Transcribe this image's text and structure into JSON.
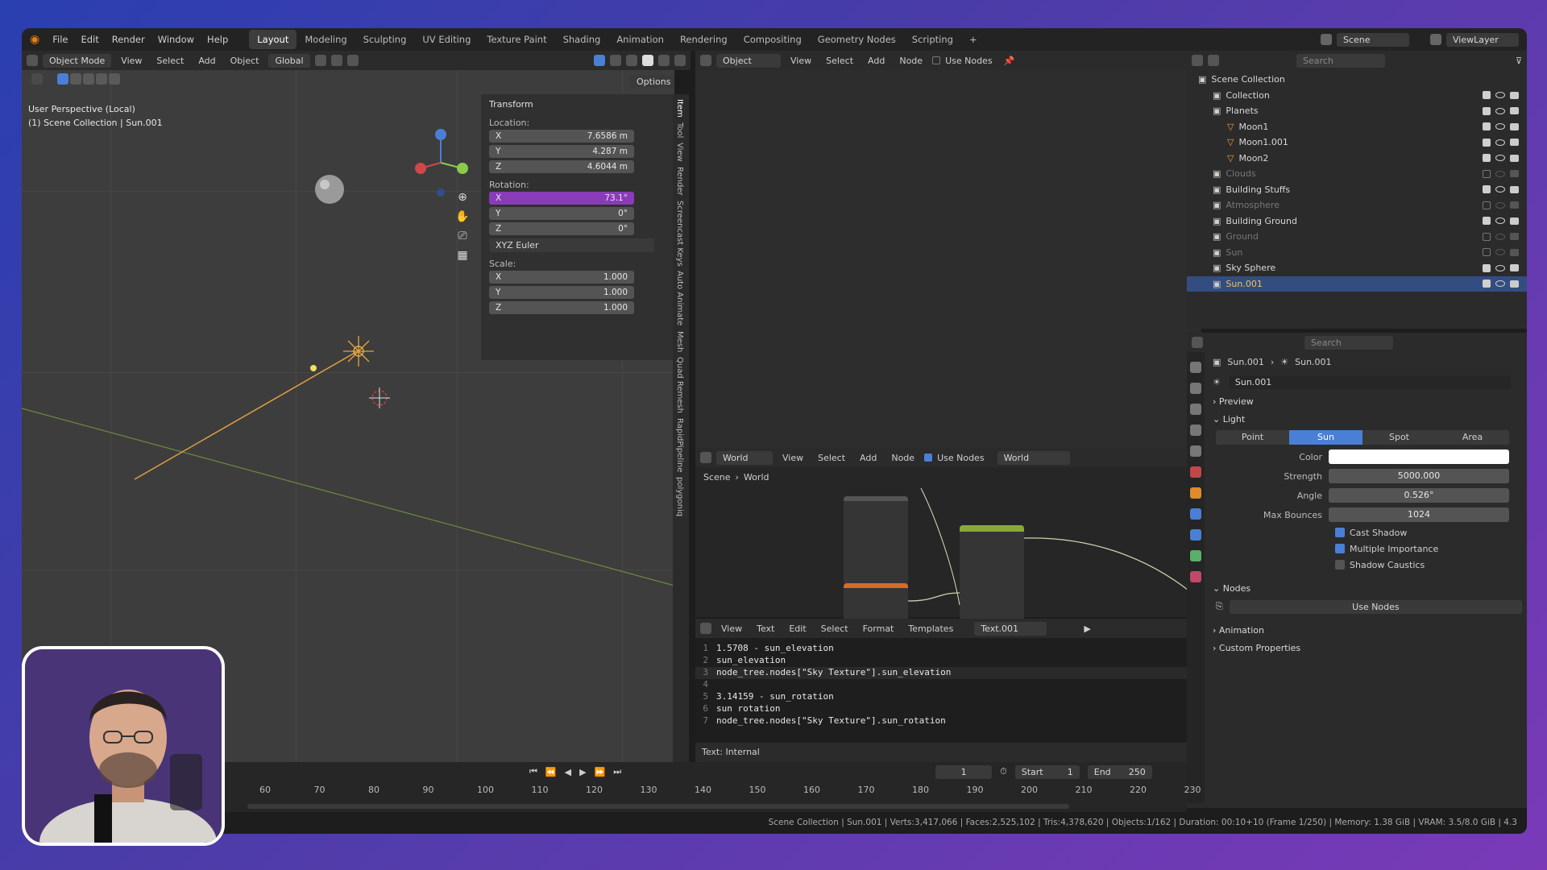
{
  "menus": [
    "File",
    "Edit",
    "Render",
    "Window",
    "Help"
  ],
  "workspaces": [
    "Layout",
    "Modeling",
    "Sculpting",
    "UV Editing",
    "Texture Paint",
    "Shading",
    "Animation",
    "Rendering",
    "Compositing",
    "Geometry Nodes",
    "Scripting",
    "+"
  ],
  "topright": {
    "scene": "Scene",
    "viewlayer": "ViewLayer"
  },
  "viewport": {
    "mode": "Object Mode",
    "menu": [
      "View",
      "Select",
      "Add",
      "Object"
    ],
    "orientation": "Global",
    "options": "Options",
    "overlay_line1": "User Perspective (Local)",
    "overlay_line2": "(1) Scene Collection | Sun.001"
  },
  "transform": {
    "title": "Transform",
    "location_label": "Location:",
    "rotation_label": "Rotation:",
    "scale_label": "Scale:",
    "location": [
      {
        "axis": "X",
        "value": "7.6586 m"
      },
      {
        "axis": "Y",
        "value": "4.287 m"
      },
      {
        "axis": "Z",
        "value": "4.6044 m"
      }
    ],
    "rotation": [
      {
        "axis": "X",
        "value": "73.1°"
      },
      {
        "axis": "Y",
        "value": "0°"
      },
      {
        "axis": "Z",
        "value": "0°"
      }
    ],
    "rotation_mode": "XYZ Euler",
    "scale": [
      {
        "axis": "X",
        "value": "1.000"
      },
      {
        "axis": "Y",
        "value": "1.000"
      },
      {
        "axis": "Z",
        "value": "1.000"
      }
    ]
  },
  "side_tabs": [
    "Item",
    "Tool",
    "View",
    "Render",
    "Screencast Keys",
    "Auto Animate",
    "Mesh",
    "Quad Remesh",
    "RapidPipeline",
    "polygoniq"
  ],
  "shader_top": {
    "type": "Object",
    "menu": [
      "View",
      "Select",
      "Add",
      "Node"
    ],
    "use_nodes": "Use Nodes"
  },
  "shader_world": {
    "type": "World",
    "menu": [
      "View",
      "Select",
      "Add",
      "Node"
    ],
    "use_nodes": "Use Nodes",
    "world": "World",
    "bc_scene": "Scene",
    "bc_world": "World"
  },
  "text_editor": {
    "menu": [
      "View",
      "Text",
      "Edit",
      "Select",
      "Format",
      "Templates"
    ],
    "filename": "Text.001",
    "footer": "Text: Internal",
    "lines": [
      {
        "n": "1",
        "t": "1.5708 - sun_elevation"
      },
      {
        "n": "2",
        "t": "sun_elevation"
      },
      {
        "n": "3",
        "t": "node_tree.nodes[\"Sky Texture\"].sun_elevation"
      },
      {
        "n": "4",
        "t": ""
      },
      {
        "n": "5",
        "t": "3.14159 - sun_rotation"
      },
      {
        "n": "6",
        "t": "sun rotation"
      },
      {
        "n": "7",
        "t": "node_tree.nodes[\"Sky Texture\"].sun_rotation"
      }
    ]
  },
  "outliner": {
    "search": "Search",
    "items": [
      {
        "name": "Scene Collection",
        "depth": 0,
        "dim": false,
        "sel": false
      },
      {
        "name": "Collection",
        "depth": 1,
        "dim": false,
        "sel": false
      },
      {
        "name": "Planets",
        "depth": 1,
        "dim": false,
        "sel": false
      },
      {
        "name": "Moon1",
        "depth": 2,
        "dim": false,
        "sel": false
      },
      {
        "name": "Moon1.001",
        "depth": 2,
        "dim": false,
        "sel": false
      },
      {
        "name": "Moon2",
        "depth": 2,
        "dim": false,
        "sel": false
      },
      {
        "name": "Clouds",
        "depth": 1,
        "dim": true,
        "sel": false
      },
      {
        "name": "Building Stuffs",
        "depth": 1,
        "dim": false,
        "sel": false
      },
      {
        "name": "Atmosphere",
        "depth": 1,
        "dim": true,
        "sel": false
      },
      {
        "name": "Building Ground",
        "depth": 1,
        "dim": false,
        "sel": false
      },
      {
        "name": "Ground",
        "depth": 1,
        "dim": true,
        "sel": false
      },
      {
        "name": "Sun",
        "depth": 1,
        "dim": true,
        "sel": false
      },
      {
        "name": "Sky Sphere",
        "depth": 1,
        "dim": false,
        "sel": false
      },
      {
        "name": "Sun.001",
        "depth": 1,
        "dim": false,
        "sel": true
      }
    ]
  },
  "properties": {
    "search": "Search",
    "bc_object": "Sun.001",
    "bc_data": "Sun.001",
    "datablock": "Sun.001",
    "preview": "Preview",
    "light": "Light",
    "light_types": [
      "Point",
      "Sun",
      "Spot",
      "Area"
    ],
    "fields": [
      {
        "label": "Color",
        "value": ""
      },
      {
        "label": "Strength",
        "value": "5000.000"
      },
      {
        "label": "Angle",
        "value": "0.526°"
      },
      {
        "label": "Max Bounces",
        "value": "1024"
      }
    ],
    "checks": [
      {
        "label": "Cast Shadow",
        "on": true
      },
      {
        "label": "Multiple Importance",
        "on": true
      },
      {
        "label": "Shadow Caustics",
        "on": false
      }
    ],
    "nodes": "Nodes",
    "use_nodes": "Use Nodes",
    "animation": "Animation",
    "custom": "Custom Properties"
  },
  "timeline": {
    "frame": "1",
    "start_label": "Start",
    "start": "1",
    "end_label": "End",
    "end": "250",
    "ticks": [
      "60",
      "70",
      "80",
      "90",
      "100",
      "110",
      "120",
      "130",
      "140",
      "150",
      "160",
      "170",
      "180",
      "190",
      "200",
      "210",
      "220",
      "230"
    ]
  },
  "status": "Scene Collection | Sun.001 | Verts:3,417,066 | Faces:2,525,102 | Tris:4,378,620 | Objects:1/162 | Duration: 00:10+10 (Frame 1/250) | Memory: 1.38 GiB | VRAM: 3.5/8.0 GiB | 4.3"
}
